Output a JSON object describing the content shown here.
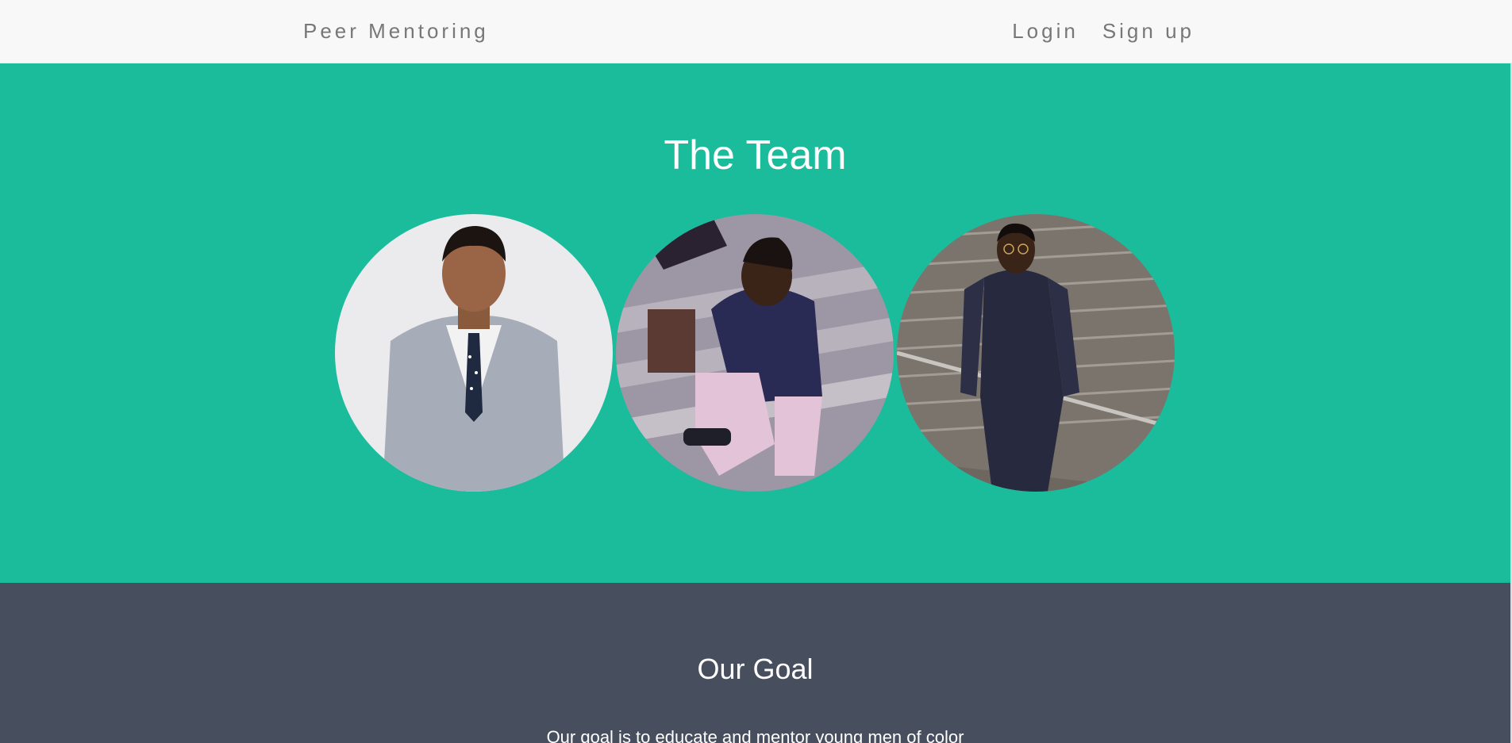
{
  "navbar": {
    "brand": "Peer Mentoring",
    "links": [
      "Login",
      "Sign up"
    ]
  },
  "team": {
    "title": "The Team",
    "members": [
      {
        "photo": "team-member-photo"
      },
      {
        "photo": "team-member-photo"
      },
      {
        "photo": "team-member-photo"
      }
    ]
  },
  "goal": {
    "title": "Our Goal",
    "text": "Our goal is to educate and mentor young men of color"
  },
  "colors": {
    "navbar_bg": "#f8f8f8",
    "nav_text": "#777777",
    "team_bg": "#1abc9c",
    "goal_bg": "#474e5d",
    "heading_text": "#ffffff"
  }
}
